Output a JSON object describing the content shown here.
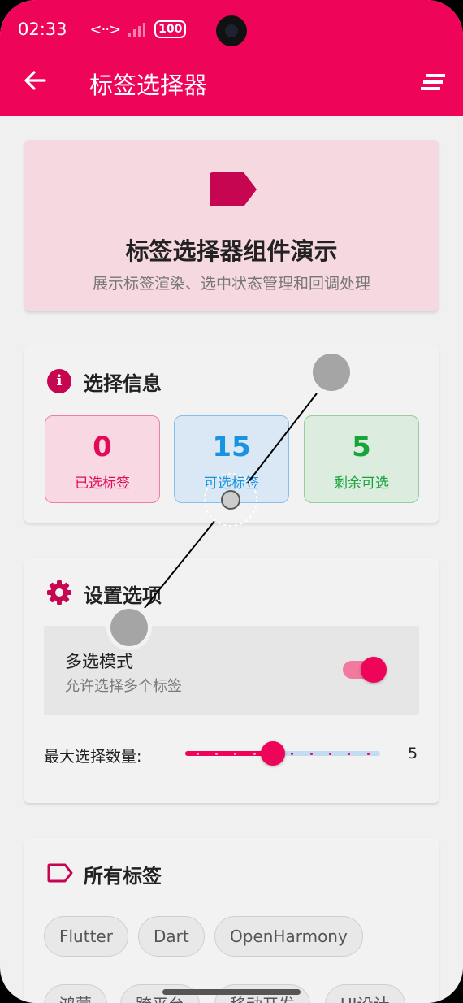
{
  "status_bar": {
    "time": "02:33",
    "network": "<··>",
    "battery": "100"
  },
  "app_bar": {
    "title": "标签选择器"
  },
  "hero": {
    "title": "标签选择器组件演示",
    "subtitle": "展示标签渲染、选中状态管理和回调处理"
  },
  "info": {
    "title": "选择信息",
    "stats": [
      {
        "value": "0",
        "label": "已选标签"
      },
      {
        "value": "15",
        "label": "可选标签"
      },
      {
        "value": "5",
        "label": "剩余可选"
      }
    ]
  },
  "settings": {
    "title": "设置选项",
    "multi_select": {
      "title": "多选模式",
      "subtitle": "允许选择多个标签",
      "enabled": true
    },
    "max_select": {
      "label": "最大选择数量:",
      "value": "5",
      "min": 1,
      "max": 10,
      "current": 5
    }
  },
  "tags": {
    "title": "所有标签",
    "row1": [
      "Flutter",
      "Dart",
      "OpenHarmony"
    ],
    "row2": [
      "鸿蒙",
      "跨平台",
      "移动开发",
      "UI设计"
    ]
  },
  "colors": {
    "primary": "#ee0459",
    "hero_bg": "#f6d8e0",
    "blue": "#1893e1",
    "green": "#17a43a"
  }
}
